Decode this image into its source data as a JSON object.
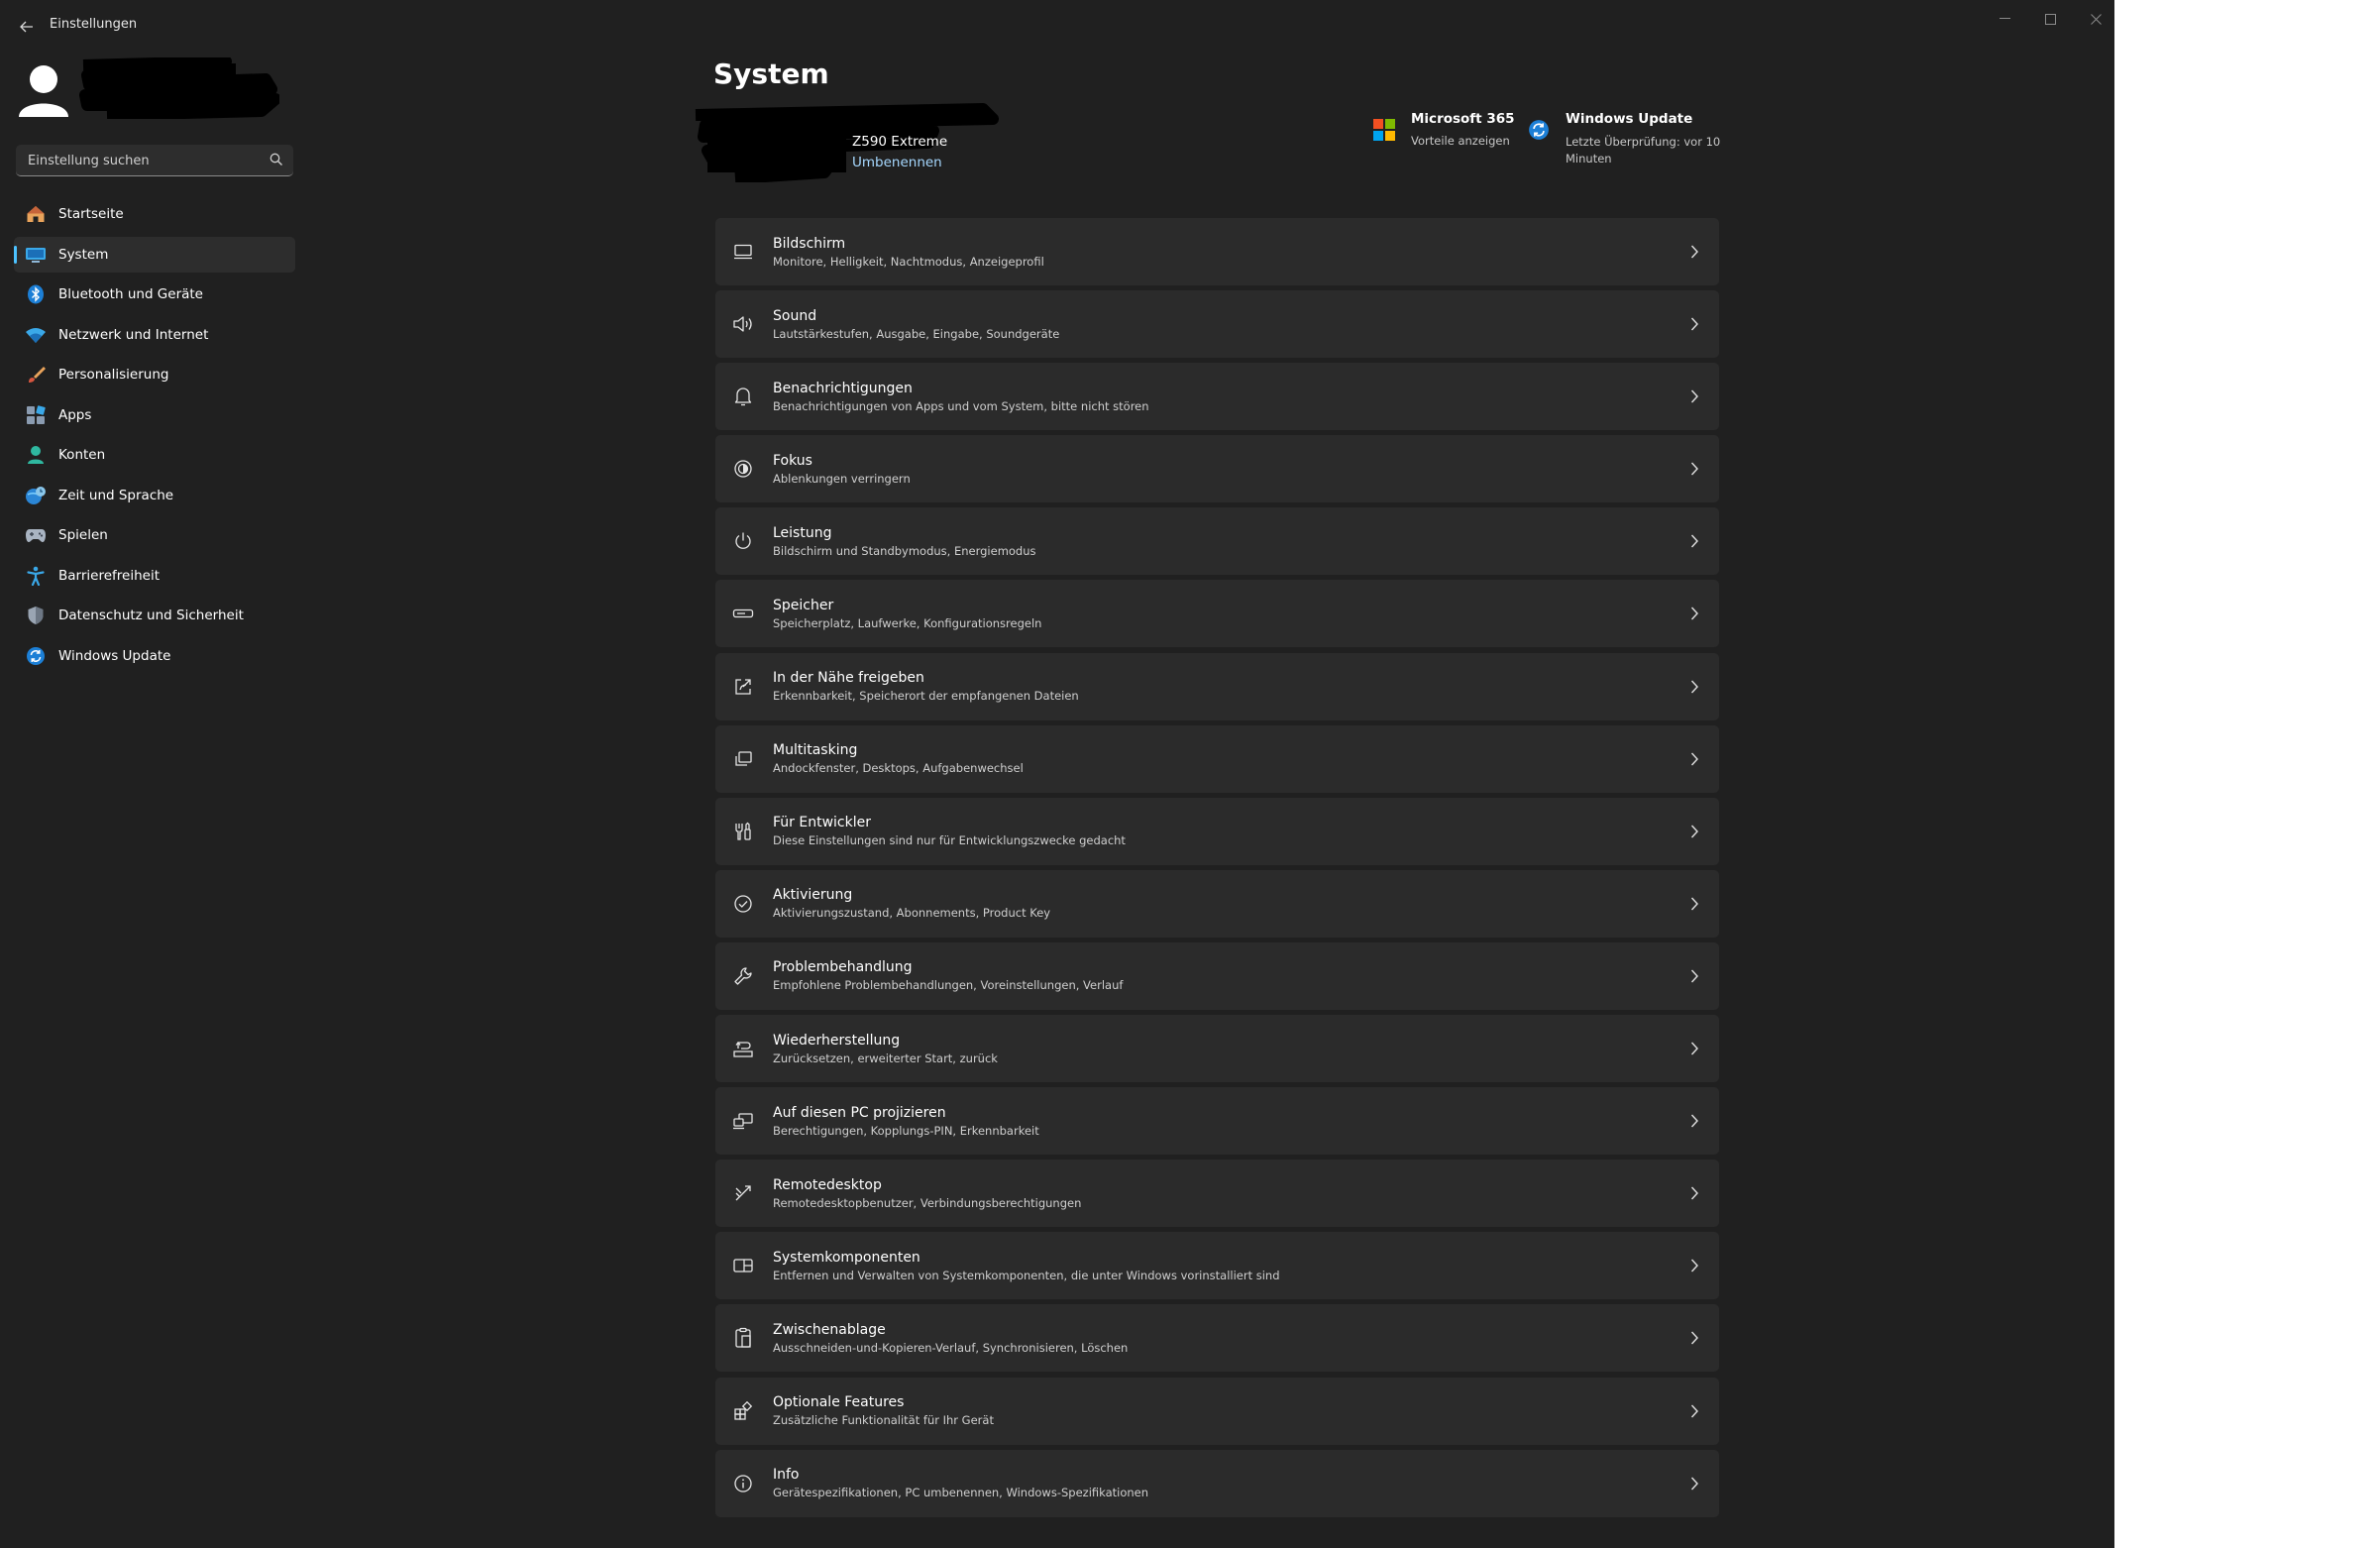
{
  "app": {
    "title": "Einstellungen"
  },
  "search": {
    "placeholder": "Einstellung suchen"
  },
  "nav": {
    "items": [
      {
        "label": "Startseite",
        "icon": "home-icon"
      },
      {
        "label": "System",
        "icon": "system-icon",
        "active": true
      },
      {
        "label": "Bluetooth und Geräte",
        "icon": "bluetooth-icon"
      },
      {
        "label": "Netzwerk und Internet",
        "icon": "wifi-icon"
      },
      {
        "label": "Personalisierung",
        "icon": "brush-icon"
      },
      {
        "label": "Apps",
        "icon": "apps-icon"
      },
      {
        "label": "Konten",
        "icon": "account-icon"
      },
      {
        "label": "Zeit und Sprache",
        "icon": "globe-clock-icon"
      },
      {
        "label": "Spielen",
        "icon": "gamepad-icon"
      },
      {
        "label": "Barrierefreiheit",
        "icon": "accessibility-icon"
      },
      {
        "label": "Datenschutz und Sicherheit",
        "icon": "shield-icon"
      },
      {
        "label": "Windows Update",
        "icon": "update-icon"
      }
    ]
  },
  "header": {
    "title": "System",
    "pc_model": "Z590 Extreme",
    "rename": "Umbenennen",
    "ms365": {
      "title": "Microsoft 365",
      "sub": "Vorteile anzeigen"
    },
    "windows_update": {
      "title": "Windows Update",
      "sub": "Letzte Überprüfung: vor 10 Minuten"
    }
  },
  "cards": [
    {
      "title": "Bildschirm",
      "sub": "Monitore, Helligkeit, Nachtmodus, Anzeigeprofil",
      "icon": "monitor-icon"
    },
    {
      "title": "Sound",
      "sub": "Lautstärkestufen, Ausgabe, Eingabe, Soundgeräte",
      "icon": "speaker-icon"
    },
    {
      "title": "Benachrichtigungen",
      "sub": "Benachrichtigungen von Apps und vom System, bitte nicht stören",
      "icon": "bell-icon"
    },
    {
      "title": "Fokus",
      "sub": "Ablenkungen verringern",
      "icon": "focus-icon"
    },
    {
      "title": "Leistung",
      "sub": "Bildschirm und Standbymodus, Energiemodus",
      "icon": "power-icon"
    },
    {
      "title": "Speicher",
      "sub": "Speicherplatz, Laufwerke, Konfigurationsregeln",
      "icon": "storage-icon"
    },
    {
      "title": "In der Nähe freigeben",
      "sub": "Erkennbarkeit, Speicherort der empfangenen Dateien",
      "icon": "share-icon"
    },
    {
      "title": "Multitasking",
      "sub": "Andockfenster, Desktops, Aufgabenwechsel",
      "icon": "multitasking-icon"
    },
    {
      "title": "Für Entwickler",
      "sub": "Diese Einstellungen sind nur für Entwicklungszwecke gedacht",
      "icon": "developer-icon"
    },
    {
      "title": "Aktivierung",
      "sub": "Aktivierungszustand, Abonnements, Product Key",
      "icon": "check-circle-icon"
    },
    {
      "title": "Problembehandlung",
      "sub": "Empfohlene Problembehandlungen, Voreinstellungen, Verlauf",
      "icon": "wrench-icon"
    },
    {
      "title": "Wiederherstellung",
      "sub": "Zurücksetzen, erweiterter Start, zurück",
      "icon": "recovery-icon"
    },
    {
      "title": "Auf diesen PC projizieren",
      "sub": "Berechtigungen, Kopplungs-PIN, Erkennbarkeit",
      "icon": "project-icon"
    },
    {
      "title": "Remotedesktop",
      "sub": "Remotedesktopbenutzer, Verbindungsberechtigungen",
      "icon": "remote-desktop-icon"
    },
    {
      "title": "Systemkomponenten",
      "sub": "Entfernen und Verwalten von Systemkomponenten, die unter Windows vorinstalliert sind",
      "icon": "components-icon"
    },
    {
      "title": "Zwischenablage",
      "sub": "Ausschneiden-und-Kopieren-Verlauf, Synchronisieren, Löschen",
      "icon": "clipboard-icon"
    },
    {
      "title": "Optionale Features",
      "sub": "Zusätzliche Funktionalität für Ihr Gerät",
      "icon": "features-icon"
    },
    {
      "title": "Info",
      "sub": "Gerätespezifikationen, PC umbenennen, Windows-Spezifikationen",
      "icon": "info-icon"
    }
  ],
  "colors": {
    "background": "#202020",
    "card": "#2b2b2b",
    "accent": "#4cc2ff",
    "link": "#a6d8ff"
  }
}
